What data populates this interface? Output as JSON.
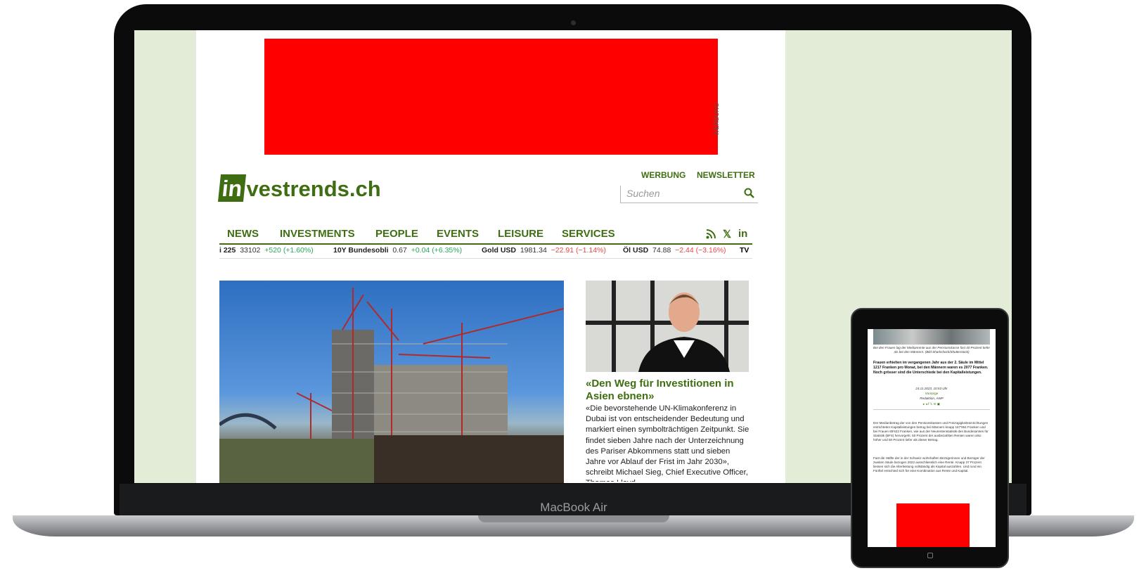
{
  "device": {
    "laptop_label": "MacBook Air"
  },
  "site": {
    "ad_label": "WERBUNG",
    "logo": {
      "box": "in",
      "rest": "vestrends.ch"
    },
    "top_links": [
      "WERBUNG",
      "NEWSLETTER"
    ],
    "search_placeholder": "Suchen",
    "nav": [
      "NEWS",
      "INVESTMENTS",
      "PEOPLE",
      "EVENTS",
      "LEISURE",
      "SERVICES"
    ],
    "social": [
      "rss-icon",
      "x-icon",
      "linkedin-icon"
    ],
    "ticker": [
      {
        "name": "i 225",
        "value": "33102",
        "change": "+520 (+1.60%)",
        "dir": "pos"
      },
      {
        "name": "10Y Bundesobli",
        "value": "0.67",
        "change": "+0.04 (+6.35%)",
        "dir": "pos"
      },
      {
        "name": "Gold USD",
        "value": "1981.34",
        "change": "−22.91 (−1.14%)",
        "dir": "neg"
      },
      {
        "name": "Öl USD",
        "value": "74.88",
        "change": "−2.44 (−3.16%)",
        "dir": "neg"
      }
    ],
    "ticker_logo": "TV",
    "article": {
      "title": "«Den Weg für Investitionen in Asien ebnen»",
      "excerpt": "«Die bevorstehende UN-Klimakonferenz in Dubai ist von entscheidender Bedeutung und markiert einen symbolträchtigen Zeitpunkt. Sie findet sieben Jahre nach der Unterzeichnung des Pariser Abkommens statt und sieben Jahre vor Ablauf der Frist im Jahr 2030», schreibt Michael Sieg, Chief Executive Officer, Thomas Lloyd"
    }
  },
  "tablet": {
    "caption": "Bei den Frauen lag der Medianrente aus der Pensionskasse fast 40 Prozent tiefer als bei den Männern. (Bild Sharkshock/Shutterstock)",
    "lead": "Frauen erhielten im vergangenen Jahr aus der 2. Säule im Mittel 1217 Franken pro Monat, bei den Männern waren es 2077 Franken. Noch grösser sind die Unterschiede bei den Kapitalleistungen.",
    "meta_date": "24.11.2023, 10:53 Uhr",
    "meta_section": "Vorsorge",
    "meta_author": "Redaktion, AWP",
    "body1": "Der Medianbetrag der von den Pensionskassen und Freizügigkeitseinrichtungen entrichteten Kapitalleistungen betrug bei Männern knapp 157'064 Franken und bei Frauen 65'622 Franken, wie aus der Neurentenstatistik des Bundesamtes für Statistik (BFS) hervorgeht. 50 Prozent der ausbezahlten Renten waren also höher und 50 Prozent tiefer als dieser Betrag.",
    "body2": "Fast die Hälfte der in der Schweiz wohnhaften Bezügerinnen und Bezüger der zweiten Säule bezogen 2022 ausschliesslich eine Rente. Knapp 37 Prozent liessen sich die Alterleistung vollständig als Kapital auszahlen. Und rund ein Fünftel entschied sich für eine Kombination aus Rente und Kapital."
  }
}
